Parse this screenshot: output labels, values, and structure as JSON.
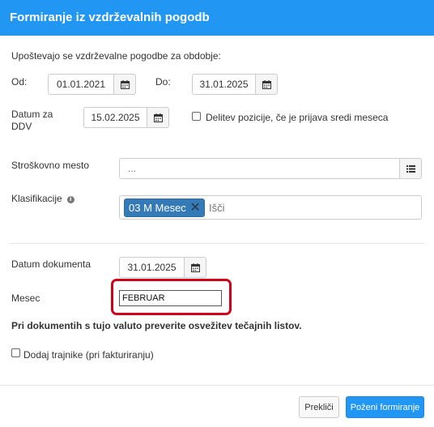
{
  "dialog": {
    "title": "Formiranje iz vzdrževalnih pogodb"
  },
  "period": {
    "intro": "Upoštevajo se vzdrževalne pogodbe za obdobje:",
    "from_label": "Od:",
    "from_value": "01.01.2021",
    "to_label": "Do:",
    "to_value": "31.01.2025"
  },
  "vat_date": {
    "label_line1": "Datum za",
    "label_line2": "DDV",
    "value": "15.02.2025"
  },
  "split_position": {
    "label": "Delitev pozicije, če je prijava sredi meseca",
    "checked": false
  },
  "cost_center": {
    "label": "Stroškovno mesto",
    "placeholder": "..."
  },
  "classification": {
    "label": "Klasifikacije",
    "tags": [
      "03 M Mesec"
    ],
    "search_placeholder": "Išči"
  },
  "document": {
    "date_label": "Datum dokumenta",
    "date_value": "31.01.2025",
    "month_label": "Mesec",
    "month_value": "FEBRUAR"
  },
  "currency_notice": "Pri dokumentih s tujo valuto preverite osvežitev tečajnih listov.",
  "add_trainees": {
    "label": "Dodaj trajnike (pri fakturiranju)",
    "checked": false
  },
  "buttons": {
    "cancel": "Prekliči",
    "run": "Poženi formiranje"
  },
  "icons": {
    "calendar": "calendar-icon",
    "list": "list-icon",
    "info": "info-icon",
    "remove": "close-icon"
  },
  "colors": {
    "header": "#2196f3",
    "primary_button": "#2196f3",
    "tag": "#337ab7",
    "highlight": "#d0021b"
  }
}
